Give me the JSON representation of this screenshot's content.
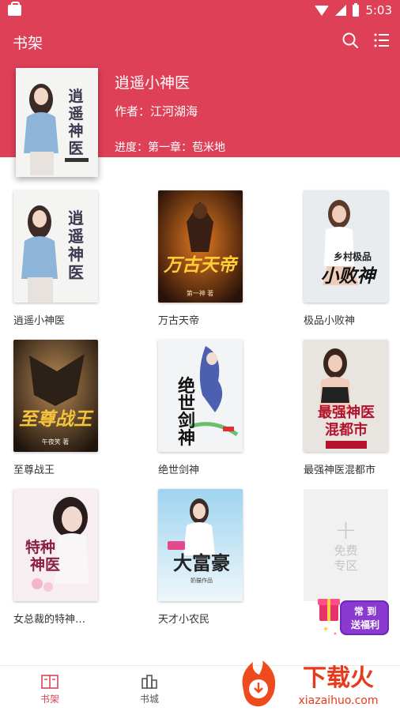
{
  "status_bar": {
    "time": "5:03"
  },
  "header": {
    "title": "书架"
  },
  "colors": {
    "brand": "#de4157"
  },
  "featured": {
    "title": "逍遥小神医",
    "author_label": "作者：",
    "author": "江河湖海",
    "progress_label": "进度：",
    "progress": "第一章：苞米地"
  },
  "books": [
    {
      "title": "逍遥小神医",
      "cover_text": "逍遥神医"
    },
    {
      "title": "万古天帝",
      "cover_text": "万古天帝"
    },
    {
      "title": "极品小败神",
      "cover_text": "小败神"
    },
    {
      "title": "至尊战王",
      "cover_text": "至尊战王"
    },
    {
      "title": "绝世剑神",
      "cover_text": "绝世剑神"
    },
    {
      "title": "最强神医混都市",
      "cover_text": "最强神医混都市"
    },
    {
      "title": "女总裁的特神…",
      "cover_text": "特种神医"
    },
    {
      "title": "天才小农民",
      "cover_text": "大富豪"
    }
  ],
  "free_zone": {
    "plus": "+",
    "line1": "免费",
    "line2": "专区"
  },
  "welfare_badge": {
    "line1": "常 到",
    "line2": "送福利"
  },
  "tabs": [
    {
      "label": "书架"
    },
    {
      "label": "书城"
    }
  ],
  "watermark": {
    "brand": "下载火",
    "url": "xiazaihuo.com"
  }
}
